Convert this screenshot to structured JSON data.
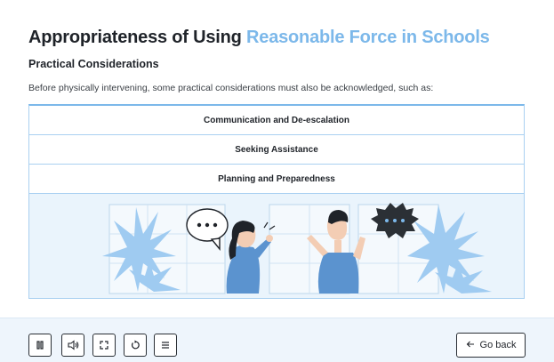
{
  "page": {
    "title_main": "Appropriateness of Using ",
    "title_accent": "Reasonable Force in Schools",
    "subtitle": "Practical Considerations",
    "intro": "Before physically intervening, some practical considerations must also be acknowledged, such as:"
  },
  "accordion": {
    "items": [
      {
        "label": "Communication and De-escalation"
      },
      {
        "label": "Seeking Assistance"
      },
      {
        "label": "Planning and Preparedness"
      }
    ]
  },
  "colors": {
    "accent": "#7cb8ea",
    "text": "#1f2329",
    "panel_bg": "#eaf4fc",
    "footer_bg": "#eef5fc"
  },
  "icons": [
    "pause-icon",
    "audio-icon",
    "fullscreen-icon",
    "replay-icon",
    "menu-icon",
    "arrow-left-icon"
  ],
  "footer": {
    "back_label": "Go back"
  }
}
